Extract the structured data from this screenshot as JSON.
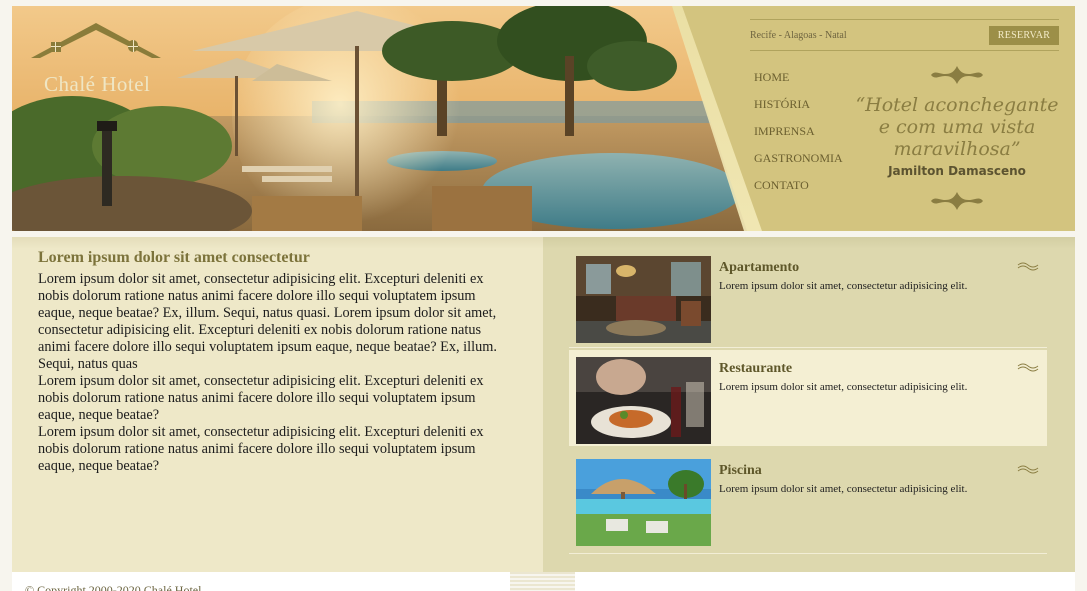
{
  "brand": {
    "name": "Chalé Hotel"
  },
  "topbar": {
    "cities": "Recife - Alagoas - Natal",
    "reserve_label": "RESERVAR"
  },
  "nav": {
    "items": [
      "HOME",
      "HISTÓRIA",
      "IMPRENSA",
      "GASTRONOMIA",
      "CONTATO"
    ]
  },
  "quote": {
    "text_line1": "“Hotel aconchegante",
    "text_line2": "e com uma vista",
    "text_line3": "maravilhosa”",
    "author": "Jamilton Damasceno"
  },
  "article": {
    "title": "Lorem ipsum dolor sit amet consectetur",
    "paragraph1": "Lorem ipsum dolor sit amet, consectetur adipisicing elit. Excepturi deleniti ex nobis dolorum ratione natus animi facere dolore illo sequi voluptatem ipsum eaque, neque beatae? Ex, illum. Sequi, natus quasi. Lorem ipsum dolor sit amet, consectetur adipisicing elit. Excepturi deleniti ex nobis dolorum ratione natus animi facere dolore illo sequi voluptatem ipsum eaque, neque beatae? Ex, illum. Sequi, natus quas",
    "paragraph2": "Lorem ipsum dolor sit amet, consectetur adipisicing elit. Excepturi deleniti ex nobis dolorum ratione natus animi facere dolore illo sequi voluptatem ipsum eaque, neque beatae?",
    "paragraph3": "Lorem ipsum dolor sit amet, consectetur adipisicing elit. Excepturi deleniti ex nobis dolorum ratione natus animi facere dolore illo sequi voluptatem ipsum eaque, neque beatae?"
  },
  "cards": [
    {
      "title": "Apartamento",
      "desc": "Lorem ipsum dolor sit amet, consectetur adipisicing elit."
    },
    {
      "title": "Restaurante",
      "desc": "Lorem ipsum dolor sit amet, consectetur adipisicing elit."
    },
    {
      "title": "Piscina",
      "desc": "Lorem ipsum dolor sit amet, consectetur adipisicing elit."
    }
  ],
  "footer": {
    "copyright": "© Copyright 2000-2020 Chalé Hotel"
  },
  "colors": {
    "header_bg": "#d3c47f",
    "accent": "#9c8f48",
    "title": "#7c733b",
    "panel_left": "#eee8c8",
    "panel_right": "#ddd8ae"
  },
  "icons": [
    "house-logo-icon",
    "ornament-top-icon",
    "ornament-bottom-icon",
    "wave-icon"
  ]
}
